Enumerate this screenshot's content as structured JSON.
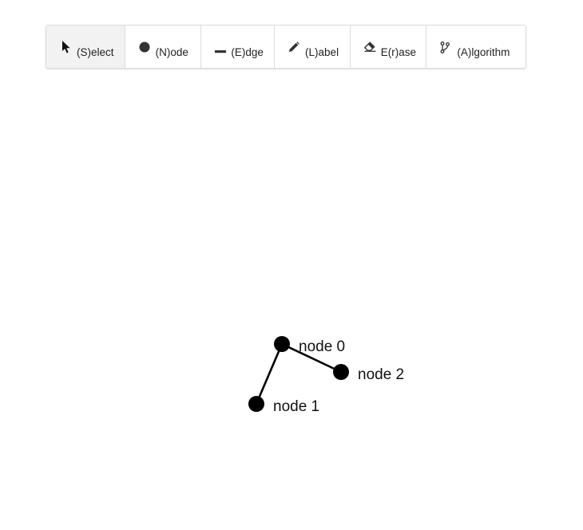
{
  "toolbar": {
    "tools": [
      {
        "key": "select",
        "label": "(S)elect",
        "icon": "cursor-arrow-icon",
        "active": true
      },
      {
        "key": "node",
        "label": "(N)ode",
        "icon": "circle-icon",
        "active": false
      },
      {
        "key": "edge",
        "label": "(E)dge",
        "icon": "line-icon",
        "active": false
      },
      {
        "key": "label",
        "label": "(L)abel",
        "icon": "pencil-icon",
        "active": false
      },
      {
        "key": "erase",
        "label": "E(r)ase",
        "icon": "eraser-icon",
        "active": false
      },
      {
        "key": "algorithm",
        "label": "(A)lgorithm",
        "icon": "branch-icon",
        "active": false
      }
    ]
  },
  "graph": {
    "nodes": [
      {
        "id": 0,
        "label": "node 0"
      },
      {
        "id": 1,
        "label": "node 1"
      },
      {
        "id": 2,
        "label": "node 2"
      }
    ],
    "edges": [
      {
        "from": 0,
        "to": 1
      },
      {
        "from": 0,
        "to": 2
      }
    ]
  },
  "colors": {
    "node_fill": "#000000",
    "edge_stroke": "#000000",
    "active_tool_bg": "#f2f2f2",
    "toolbar_border": "#dcdcdc"
  }
}
